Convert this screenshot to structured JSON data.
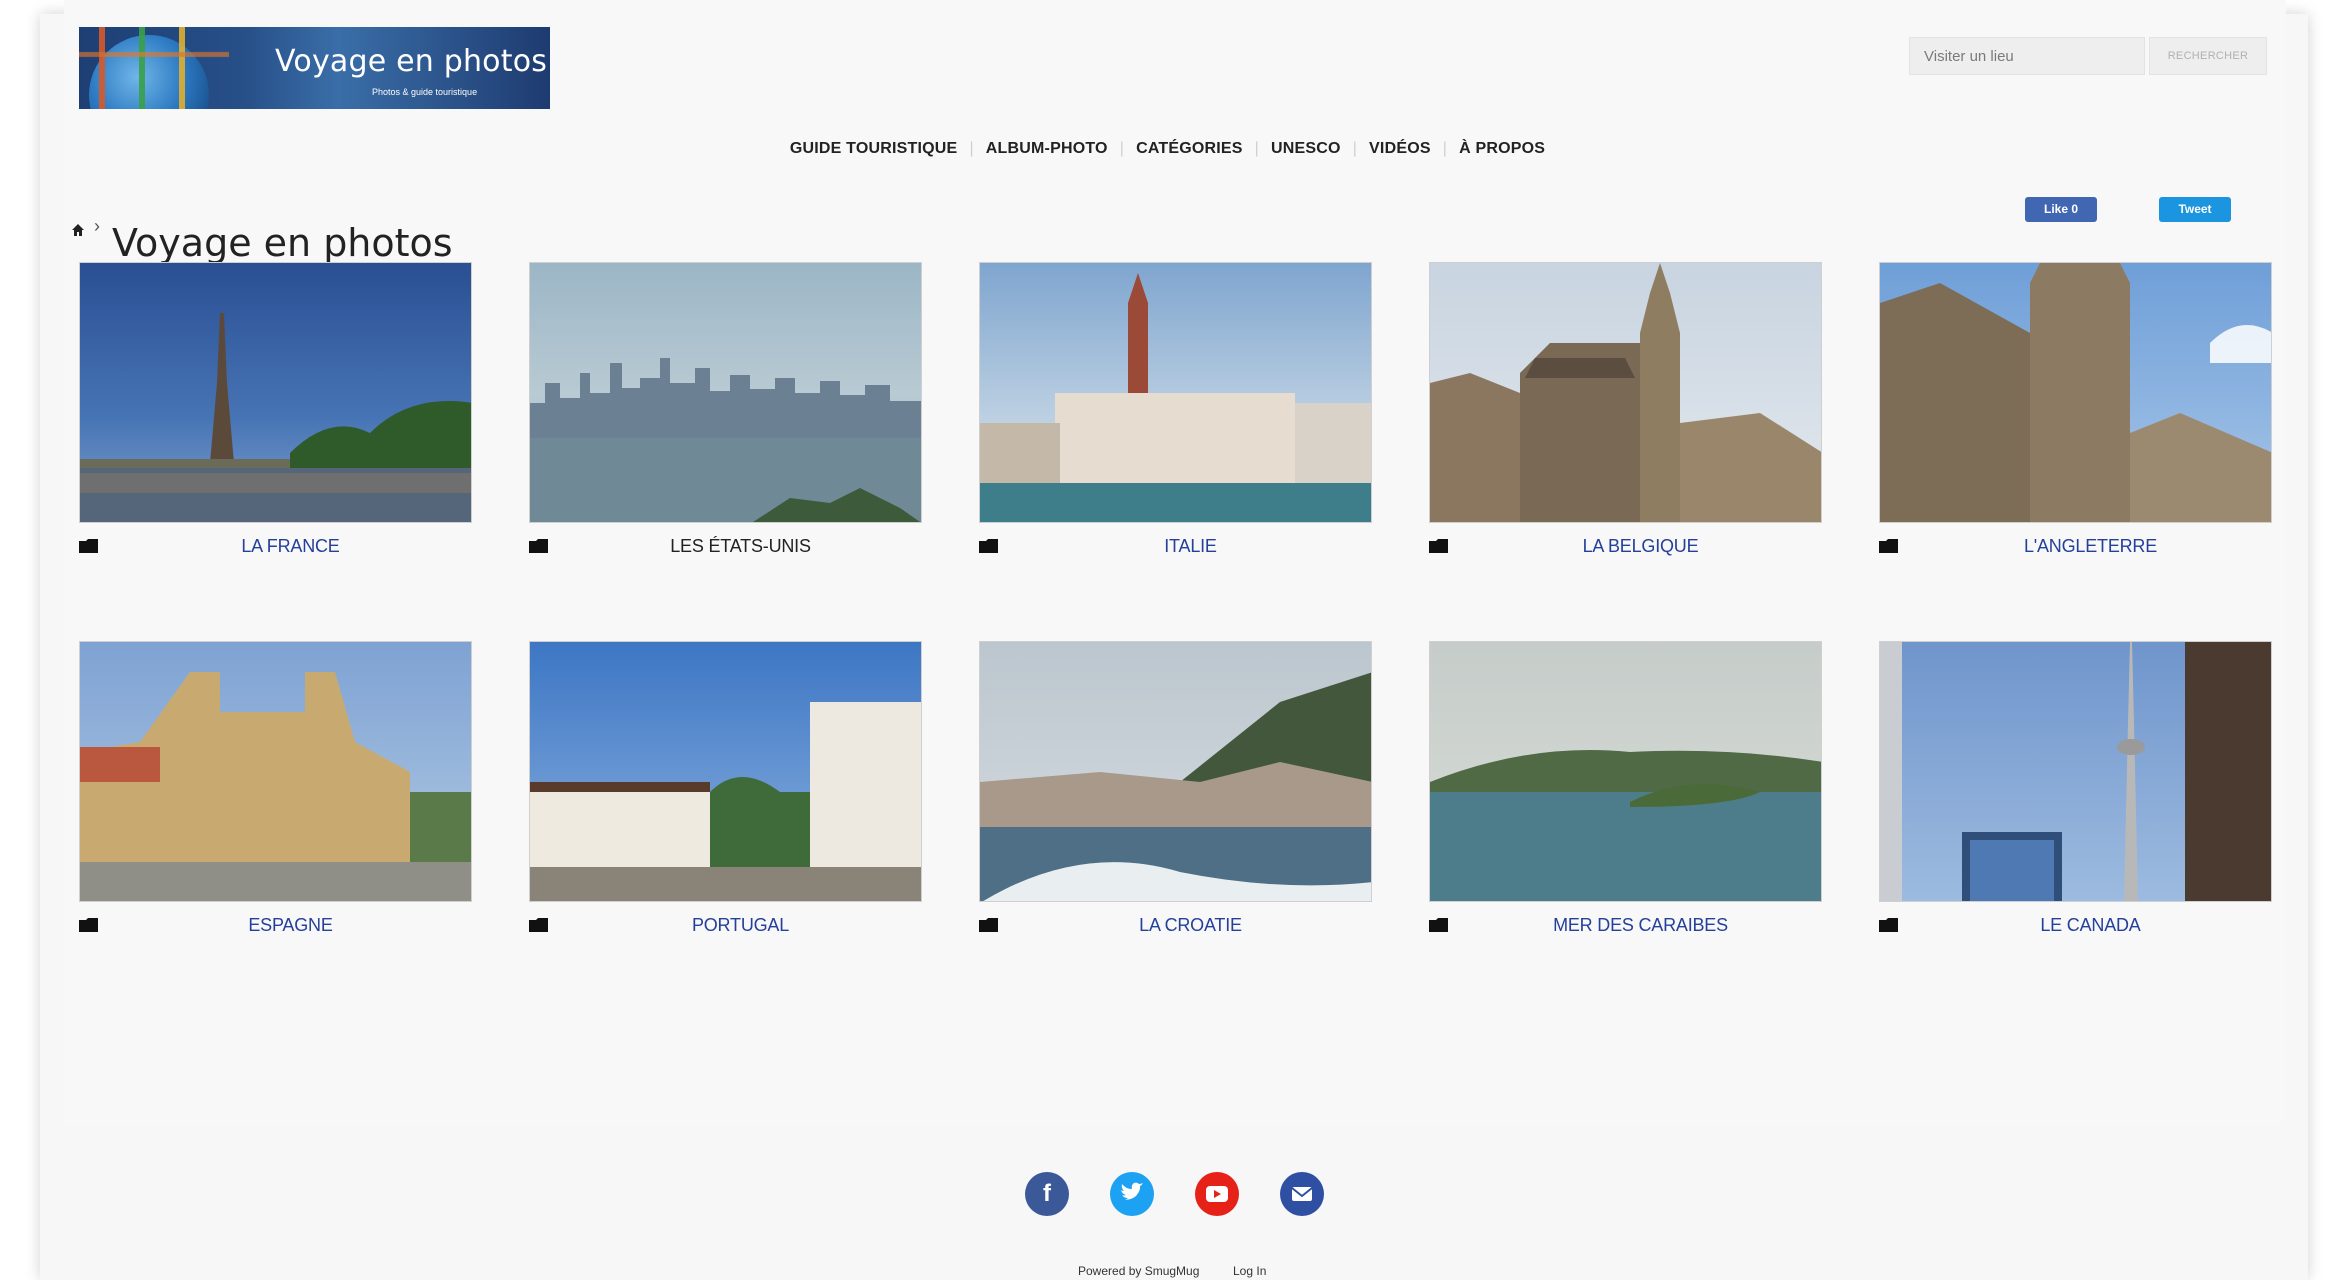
{
  "header": {
    "logo_title": "Voyage en photos",
    "logo_subtitle": "Photos & guide touristique",
    "search_placeholder": "Visiter un lieu",
    "search_button": "RECHERCHER"
  },
  "nav": {
    "items": [
      "GUIDE TOURISTIQUE",
      "ALBUM-PHOTO",
      "CATÉGORIES",
      "UNESCO",
      "VIDÉOS",
      "À PROPOS"
    ]
  },
  "breadcrumb": {
    "separator": "›",
    "title": "Voyage en photos"
  },
  "social_buttons": {
    "like": "Like 0",
    "tweet": "Tweet"
  },
  "gallery": [
    {
      "label": "LA FRANCE",
      "scene": "eiffel-tower"
    },
    {
      "label": "LES ÉTATS-UNIS",
      "scene": "new-york-skyline"
    },
    {
      "label": "ITALIE",
      "scene": "venice-campanile"
    },
    {
      "label": "LA BELGIQUE",
      "scene": "brussels-town-hall"
    },
    {
      "label": "L'ANGLETERRE",
      "scene": "canterbury-cathedral"
    },
    {
      "label": "ESPAGNE",
      "scene": "san-sebastian-city-hall"
    },
    {
      "label": "PORTUGAL",
      "scene": "funchal-square"
    },
    {
      "label": "LA CROATIE",
      "scene": "dubrovnik-coast"
    },
    {
      "label": "MER DES CARAIBES",
      "scene": "caribbean-island"
    },
    {
      "label": "LE CANADA",
      "scene": "cn-tower"
    }
  ],
  "footer": {
    "icons": [
      "facebook-icon",
      "twitter-icon",
      "youtube-icon",
      "email-icon"
    ],
    "powered_by": "Powered by SmugMug",
    "login": "Log In"
  },
  "colors": {
    "link": "#24409a",
    "facebook": "#3b5998",
    "twitter": "#1da1f2",
    "youtube": "#e62117",
    "email": "#2f4fa3"
  }
}
